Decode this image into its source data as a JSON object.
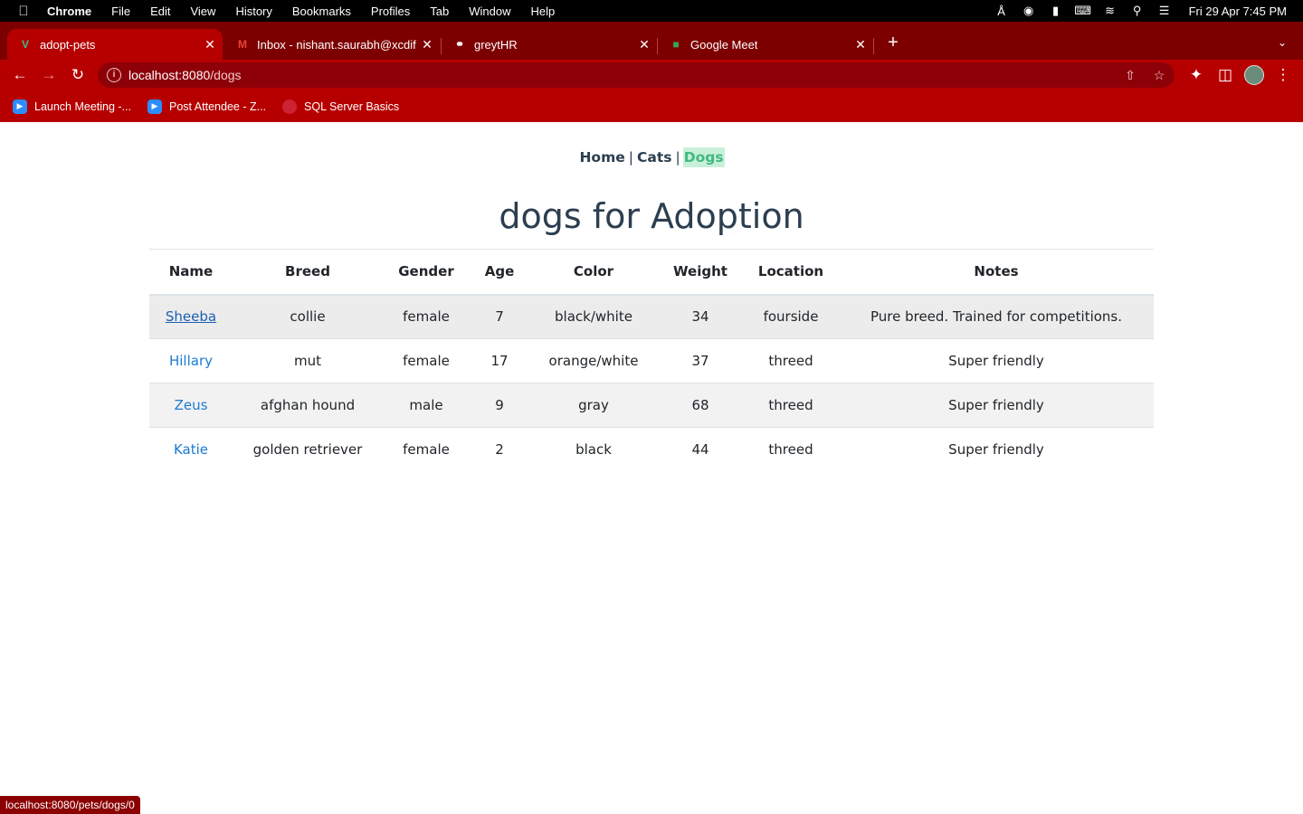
{
  "menubar": {
    "app_name": "Chrome",
    "items": [
      "File",
      "Edit",
      "View",
      "History",
      "Bookmarks",
      "Profiles",
      "Tab",
      "Window",
      "Help"
    ],
    "clock": "Fri 29 Apr  7:45 PM"
  },
  "tabs": [
    {
      "title": "adopt-pets",
      "icon": "vue-icon"
    },
    {
      "title": "Inbox - nishant.saurabh@xcdify",
      "icon": "gmail-icon"
    },
    {
      "title": "greytHR",
      "icon": "globe-icon"
    },
    {
      "title": "Google Meet",
      "icon": "meet-icon"
    }
  ],
  "address": {
    "host": "localhost:8080",
    "path": "/dogs"
  },
  "bookmarks": [
    {
      "label": "Launch Meeting -...",
      "icon": "zoom-icon"
    },
    {
      "label": "Post Attendee - Z...",
      "icon": "zoom-icon"
    },
    {
      "label": "SQL Server Basics",
      "icon": "sql-icon"
    }
  ],
  "nav": {
    "home": "Home",
    "cats": "Cats",
    "dogs": "Dogs",
    "separator": "|"
  },
  "heading": "dogs for Adoption",
  "table": {
    "headers": [
      "Name",
      "Breed",
      "Gender",
      "Age",
      "Color",
      "Weight",
      "Location",
      "Notes"
    ],
    "rows": [
      {
        "name": "Sheeba",
        "breed": "collie",
        "gender": "female",
        "age": "7",
        "color": "black/white",
        "weight": "34",
        "location": "fourside",
        "notes": "Pure breed. Trained for competitions."
      },
      {
        "name": "Hillary",
        "breed": "mut",
        "gender": "female",
        "age": "17",
        "color": "orange/white",
        "weight": "37",
        "location": "threed",
        "notes": "Super friendly"
      },
      {
        "name": "Zeus",
        "breed": "afghan hound",
        "gender": "male",
        "age": "9",
        "color": "gray",
        "weight": "68",
        "location": "threed",
        "notes": "Super friendly"
      },
      {
        "name": "Katie",
        "breed": "golden retriever",
        "gender": "female",
        "age": "2",
        "color": "black",
        "weight": "44",
        "location": "threed",
        "notes": "Super friendly"
      }
    ]
  },
  "status_url": "localhost:8080/pets/dogs/0",
  "colors": {
    "chrome_theme": "#b60000",
    "tabstrip": "#7d0000",
    "vue_green": "#42b983",
    "heading": "#2c3e50",
    "link": "#1a7ad4"
  }
}
